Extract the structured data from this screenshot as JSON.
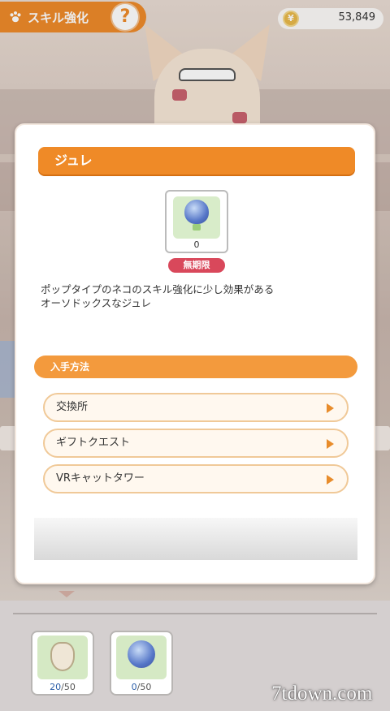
{
  "topbar": {
    "title": "スキル強化",
    "help_label": "?",
    "coins": "53,849"
  },
  "dialog": {
    "item_name": "ジュレ",
    "item_count": "0",
    "duration_badge": "無期限",
    "description": [
      "ポップタイプのネコのスキル強化に少し効果がある",
      "オーソドックスなジュレ"
    ],
    "acquire_header": "入手方法",
    "sources": [
      {
        "label": "交換所"
      },
      {
        "label": "ギフトクエスト"
      },
      {
        "label": "VRキャットタワー"
      }
    ]
  },
  "inventory": [
    {
      "current": "20",
      "max": "/50"
    },
    {
      "current": "0",
      "max": "/50"
    }
  ],
  "watermark": "7tdown.com",
  "colors": {
    "accent": "#ee8a2a",
    "badge": "#d9485b",
    "button_border": "#f0c998"
  }
}
